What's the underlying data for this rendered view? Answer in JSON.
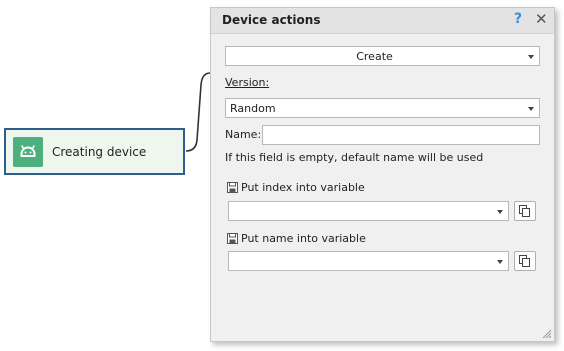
{
  "node": {
    "label": "Creating device",
    "icon": "android-icon",
    "accent": "#4caf7d"
  },
  "panel": {
    "title": "Device actions",
    "help_symbol": "?",
    "close_symbol": "✕",
    "action_select": {
      "value": "Create"
    },
    "version": {
      "label": "Version:",
      "value": "Random"
    },
    "name": {
      "label": "Name:",
      "value": "",
      "hint": "If this field is empty, default name will be used"
    },
    "index_variable": {
      "label": "Put index into variable",
      "value": ""
    },
    "name_variable": {
      "label": "Put name into variable",
      "value": ""
    }
  }
}
